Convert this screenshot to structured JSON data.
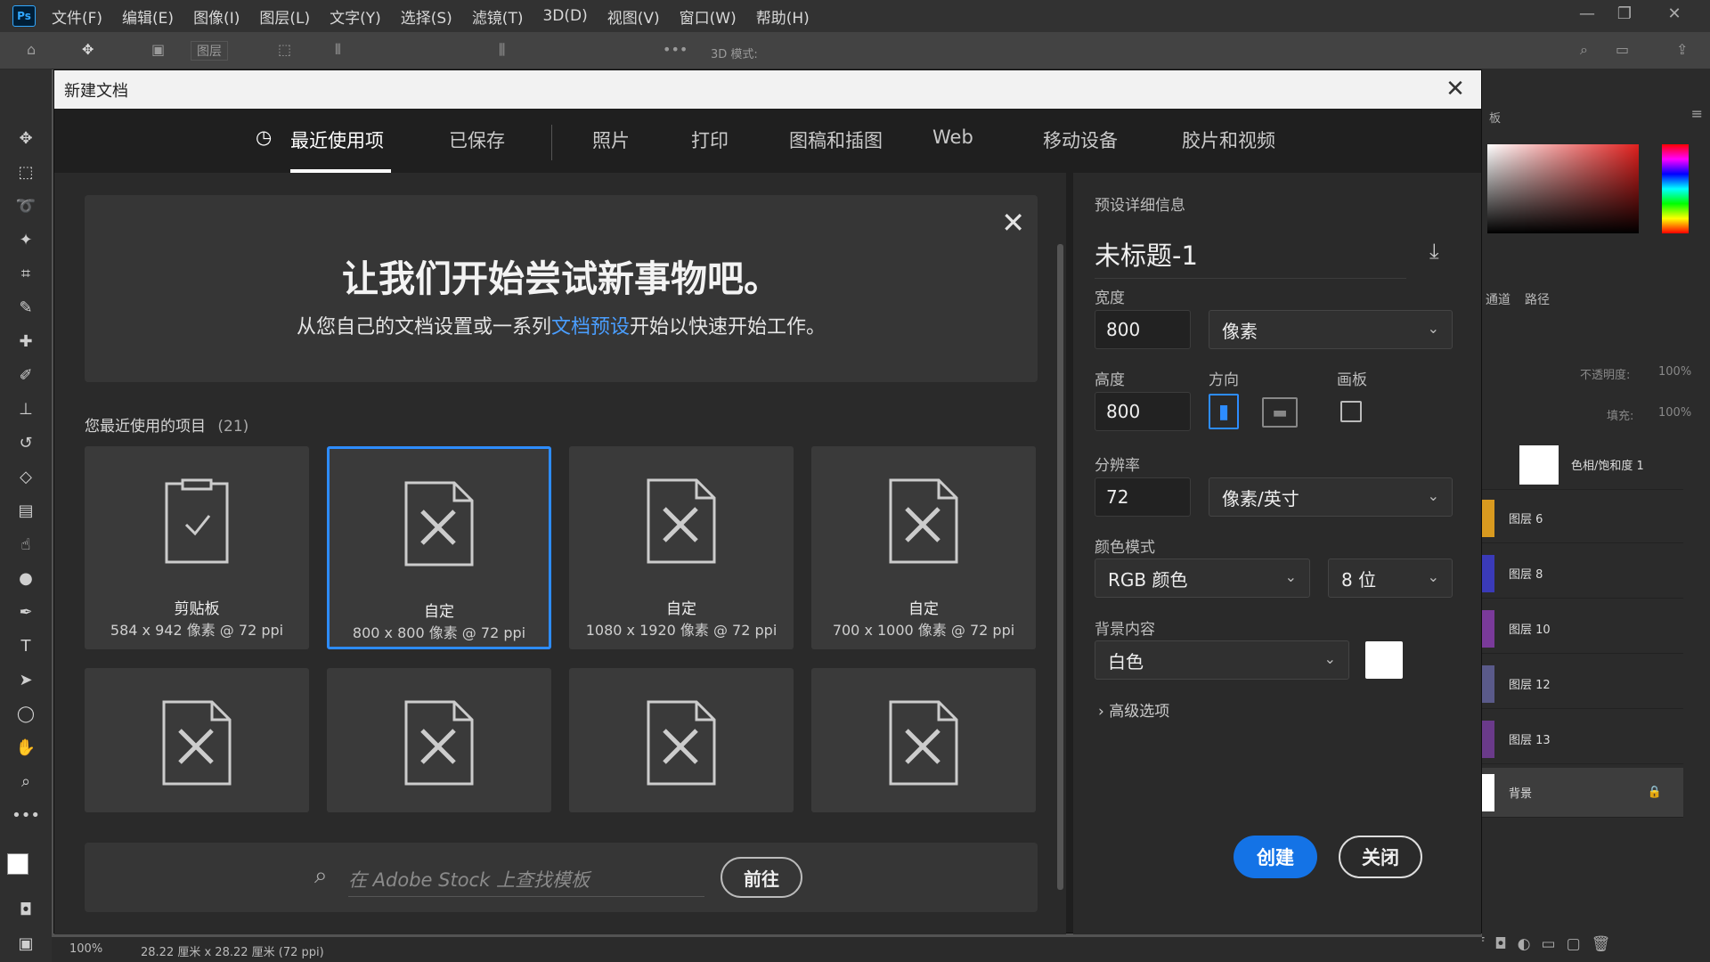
{
  "app": {
    "logo": "Ps",
    "menu": [
      "文件(F)",
      "编辑(E)",
      "图像(I)",
      "图层(L)",
      "文字(Y)",
      "选择(S)",
      "滤镜(T)",
      "3D(D)",
      "视图(V)",
      "窗口(W)",
      "帮助(H)"
    ],
    "options_bar": {
      "layer_select": "图层",
      "mode_3d": "3D 模式:"
    },
    "status": {
      "zoom": "100%",
      "doc_info": "28.22 厘米 x 28.22 厘米 (72 ppi)"
    }
  },
  "layers_panel": {
    "tabs": [
      "通道",
      "路径"
    ],
    "opacity_label": "不透明度:",
    "opacity_value": "100%",
    "fill_label": "填充:",
    "fill_value": "100%",
    "items": [
      {
        "name": "色相/饱和度 1",
        "thumb_color": "#ffffff"
      },
      {
        "name": "图层 6",
        "thumb_color": "#d99a1f"
      },
      {
        "name": "图层 8",
        "thumb_color": "#3a3ab8"
      },
      {
        "name": "图层 10",
        "thumb_color": "#7a3a9a"
      },
      {
        "name": "图层 12",
        "thumb_color": "#5a5a8a"
      },
      {
        "name": "图层 13",
        "thumb_color": "#6a3a8a"
      },
      {
        "name": "背景",
        "thumb_color": "#ffffff"
      }
    ]
  },
  "dialog": {
    "title": "新建文档",
    "tabs": [
      "最近使用项",
      "已保存",
      "照片",
      "打印",
      "图稿和插图",
      "Web",
      "移动设备",
      "胶片和视频"
    ],
    "welcome": {
      "heading": "让我们开始尝试新事物吧。",
      "text_before": "从您自己的文档设置或一系列",
      "link": "文档预设",
      "text_after": "开始以快速开始工作。"
    },
    "recent": {
      "label": "您最近使用的项目",
      "count": "(21)"
    },
    "cards": [
      {
        "name": "剪贴板",
        "sub": "584 x 942 像素 @ 72 ppi"
      },
      {
        "name": "自定",
        "sub": "800 x 800 像素 @ 72 ppi"
      },
      {
        "name": "自定",
        "sub": "1080 x 1920 像素 @ 72 ppi"
      },
      {
        "name": "自定",
        "sub": "700 x 1000 像素 @ 72 ppi"
      }
    ],
    "stock": {
      "placeholder": "在 Adobe Stock 上查找模板",
      "button": "前往"
    },
    "preset": {
      "section_label": "预设详细信息",
      "name": "未标题-1",
      "width_label": "宽度",
      "width": "800",
      "width_unit": "像素",
      "height_label": "高度",
      "height": "800",
      "orientation_label": "方向",
      "artboard_label": "画板",
      "resolution_label": "分辨率",
      "resolution": "72",
      "resolution_unit": "像素/英寸",
      "color_mode_label": "颜色模式",
      "color_mode": "RGB 颜色",
      "bit_depth": "8 位",
      "bg_label": "背景内容",
      "bg_value": "白色",
      "advanced": "高级选项",
      "create": "创建",
      "close": "关闭"
    }
  }
}
